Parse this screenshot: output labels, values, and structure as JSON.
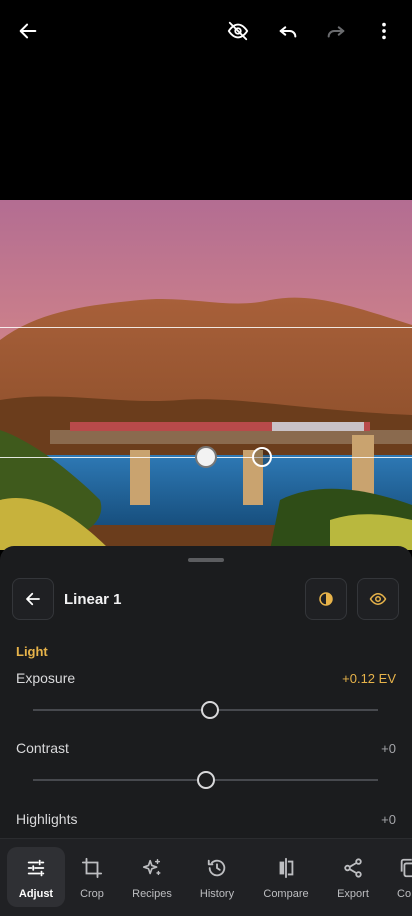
{
  "topbar": {
    "icons": [
      "back-arrow-icon",
      "hide-mask-icon",
      "undo-icon",
      "redo-icon",
      "more-vertical-icon"
    ]
  },
  "panel": {
    "title": "Linear 1",
    "section": "Light",
    "sliders": [
      {
        "label": "Exposure",
        "value": "+0.12 EV",
        "position": 0.51,
        "active": true
      },
      {
        "label": "Contrast",
        "value": "+0",
        "position": 0.5,
        "active": false
      },
      {
        "label": "Highlights",
        "value": "+0",
        "active": false
      }
    ]
  },
  "nav": {
    "items": [
      {
        "label": "Adjust",
        "icon": "sliders-icon",
        "active": true
      },
      {
        "label": "Crop",
        "icon": "crop-icon"
      },
      {
        "label": "Recipes",
        "icon": "sparkle-icon"
      },
      {
        "label": "History",
        "icon": "history-icon"
      },
      {
        "label": "Compare",
        "icon": "compare-icon"
      },
      {
        "label": "Export",
        "icon": "share-icon"
      },
      {
        "label": "Co",
        "icon": "copy-icon"
      }
    ]
  },
  "colors": {
    "accent": "#e7b34a",
    "panel": "#1b1c1e"
  }
}
